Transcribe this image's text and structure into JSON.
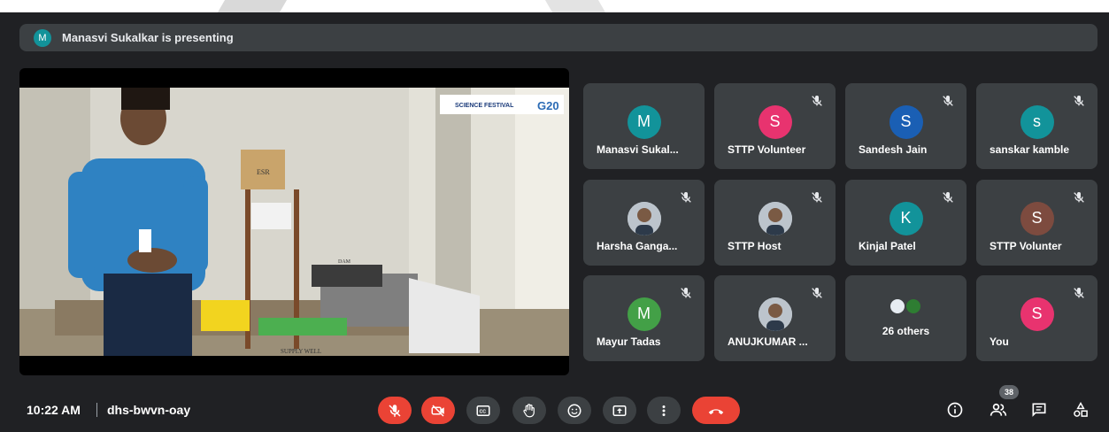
{
  "banner": {
    "avatar_initial": "M",
    "text": "Manasvi Sukalkar is presenting"
  },
  "stage": {
    "slide_labels": [
      "SCIENCE FESTIVAL",
      "G20",
      "ESR",
      "SUPPLY WELL",
      "DAM"
    ]
  },
  "tiles": [
    {
      "name": "Manasvi Sukal...",
      "initial": "M",
      "color": "#12939a",
      "muted": false
    },
    {
      "name": "STTP Volunteer",
      "initial": "S",
      "color": "#e8336f",
      "muted": true
    },
    {
      "name": "Sandesh Jain",
      "initial": "S",
      "color": "#1a5fb4",
      "muted": true
    },
    {
      "name": "sanskar kamble",
      "initial": "s",
      "color": "#12939a",
      "muted": true
    },
    {
      "name": "Harsha Ganga...",
      "initial": "",
      "color": "#cfd4d8",
      "muted": true,
      "photo": true
    },
    {
      "name": "STTP Host",
      "initial": "",
      "color": "#cfd4d8",
      "muted": true,
      "photo": true
    },
    {
      "name": "Kinjal Patel",
      "initial": "K",
      "color": "#12939a",
      "muted": true
    },
    {
      "name": "STTP Volunter",
      "initial": "S",
      "color": "#7d4b3f",
      "muted": true
    },
    {
      "name": "Mayur Tadas",
      "initial": "M",
      "color": "#43a047",
      "muted": true
    },
    {
      "name": "ANUJKUMAR ...",
      "initial": "",
      "color": "#cfd4d8",
      "muted": true,
      "photo": true
    },
    {
      "name": "26 others",
      "initial": "",
      "color": "#3c4043",
      "muted": false,
      "others": true
    },
    {
      "name": "You",
      "initial": "S",
      "color": "#e8336f",
      "muted": true
    }
  ],
  "bottom": {
    "time": "10:22 AM",
    "meeting_code": "dhs-bwvn-oay",
    "people_count": "38"
  },
  "controls": [
    {
      "name": "mic-off-button",
      "icon": "mic-off-icon",
      "color": "#ea4335"
    },
    {
      "name": "camera-off-button",
      "icon": "camera-off-icon",
      "color": "#ea4335"
    },
    {
      "name": "captions-button",
      "icon": "captions-icon"
    },
    {
      "name": "raise-hand-button",
      "icon": "hand-icon"
    },
    {
      "name": "reactions-button",
      "icon": "emoji-icon"
    },
    {
      "name": "present-button",
      "icon": "present-icon"
    },
    {
      "name": "more-options-button",
      "icon": "more-vert-icon"
    },
    {
      "name": "leave-call-button",
      "icon": "call-end-icon",
      "color": "#ea4335"
    }
  ]
}
